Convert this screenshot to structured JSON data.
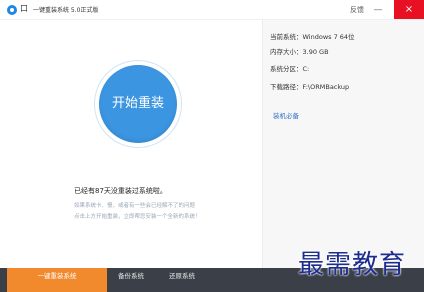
{
  "titlebar": {
    "logo_mark": "口",
    "title": "一键重装系统 5.0正式版",
    "feedback": "反馈",
    "minimize": "—",
    "close": "×"
  },
  "main": {
    "install_button": "开始重装",
    "status": "已经有87天没重装过系统啦。",
    "tips": [
      "如果系统卡、慢，或者有一些会已经解不了的问题",
      "点击上方开始重装，立即帮您安装一个全新的系统！"
    ]
  },
  "info": {
    "os_label": "当前系统：",
    "os_value": "Windows 7 64位",
    "mem_label": "内存大小：",
    "mem_value": "3.90 GB",
    "part_label": "系统分区：",
    "part_value": "C:",
    "path_label": "下载路径：",
    "path_value": "F:\\ORMBackup",
    "essentials": "装机必备"
  },
  "tabs": [
    {
      "label": "一键重装系统"
    },
    {
      "label": "备份系统"
    },
    {
      "label": "还原系统"
    }
  ],
  "watermark": "最需教育",
  "colors": {
    "accent_blue": "#3b95e0",
    "tab_active": "#f08a2c",
    "tab_bar": "#3a3f48",
    "close_red": "#e81123"
  }
}
